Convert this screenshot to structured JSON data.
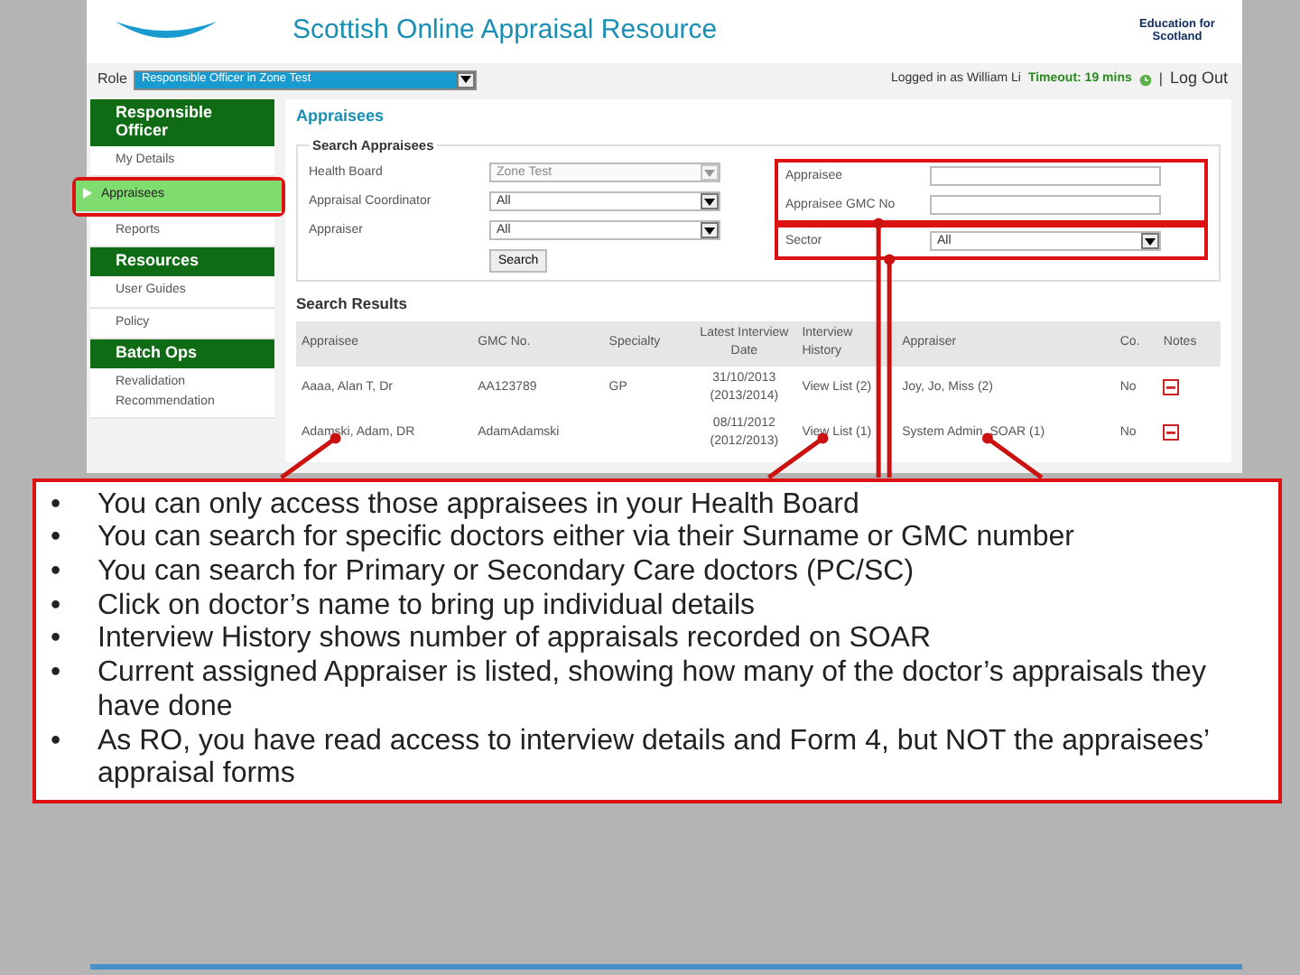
{
  "header": {
    "title": "Scottish Online Appraisal Resource",
    "partner_logo": "Education for Scotland"
  },
  "top_bar": {
    "role_label": "Role",
    "role_value": "Responsible Officer in Zone Test",
    "logged_in": "Logged in as William Li",
    "timeout": "Timeout: 19 mins",
    "separator": "|",
    "logout": "Log Out"
  },
  "sidebar": [
    {
      "title": "Responsible Officer",
      "items": [
        {
          "label": "My Details",
          "selected": false,
          "highlighted": false
        },
        {
          "label": "Appraisees",
          "selected": true,
          "highlighted": true
        },
        {
          "label": "Reports",
          "selected": false,
          "highlighted": false
        }
      ]
    },
    {
      "title": "Resources",
      "items": [
        {
          "label": "User Guides",
          "selected": false,
          "highlighted": false
        },
        {
          "label": "Policy",
          "selected": false,
          "highlighted": false
        }
      ]
    },
    {
      "title": "Batch Ops",
      "items": [
        {
          "label": "Revalidation Recommendation",
          "selected": false,
          "highlighted": false
        }
      ]
    }
  ],
  "content": {
    "heading": "Appraisees",
    "search": {
      "legend": "Search Appraisees",
      "left_fields": [
        {
          "label": "Health Board",
          "kind": "select",
          "value": "Zone Test",
          "disabled": true
        },
        {
          "label": "Appraisal Coordinator",
          "kind": "select",
          "value": "All",
          "disabled": false
        },
        {
          "label": "Appraiser",
          "kind": "select",
          "value": "All",
          "disabled": false
        }
      ],
      "button": "Search",
      "right_groups": [
        {
          "highlighted": true,
          "fields": [
            {
              "label": "Appraisee",
              "kind": "input"
            },
            {
              "label": "Appraisee GMC No",
              "kind": "input"
            }
          ]
        },
        {
          "highlighted": true,
          "fields": [
            {
              "label": "Sector",
              "kind": "select",
              "value": "All",
              "disabled": false
            }
          ]
        }
      ]
    },
    "results": {
      "heading": "Search Results",
      "columns": [
        "Appraisee",
        "GMC No.",
        "Specialty",
        "Latest Interview Date",
        "Interview History",
        "Appraiser",
        "Co.",
        "Notes"
      ],
      "rows": [
        [
          "Aaaa, Alan T, Dr",
          "AA123789",
          "GP",
          "31/10/2013 (2013/2014)",
          "View List (2)",
          "Joy, Jo, Miss (2)",
          "No"
        ],
        [
          "Adamski, Adam, DR",
          "AdamAdamski",
          "",
          "08/11/2012 (2012/2013)",
          "View List (1)",
          "System Admin, SOAR (1)",
          "No"
        ]
      ]
    }
  },
  "notes": [
    {
      "bullet": "•",
      "text": "You can only access those appraisees in your Health Board"
    },
    {
      "bullet": "•",
      "text": "You can search for specific doctors either via their Surname or GMC number"
    },
    {
      "bullet": "•",
      "text": "You can search for Primary or Secondary Care doctors (PC/SC)"
    },
    {
      "bullet": "•",
      "text": "Click on doctor’s name to bring up individual details"
    },
    {
      "bullet": "•",
      "text": "Interview History shows number of appraisals recorded on SOAR"
    },
    {
      "bullet": "•",
      "text": "Current assigned Appraiser is listed, showing how many of the doctor’s appraisals they have done"
    },
    {
      "bullet": "•",
      "text": "As RO, you have read access to interview details and Form 4, but NOT the appraisees’ appraisal forms"
    }
  ]
}
